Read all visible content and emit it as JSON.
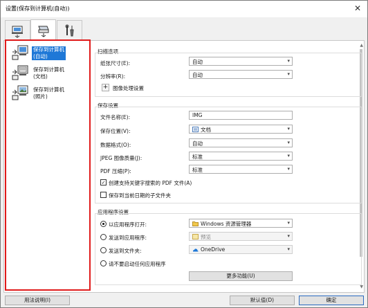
{
  "window": {
    "title": "设置(保存到计算机(自动))",
    "close": "✕"
  },
  "tabs": [
    {
      "name": "scan-from-computer",
      "active": false
    },
    {
      "name": "scan-from-operation-panel",
      "active": true
    },
    {
      "name": "general-settings",
      "active": false
    }
  ],
  "sidebar": {
    "items": [
      {
        "label_line1": "保存到计算机",
        "label_line2": "(自动)",
        "selected": true
      },
      {
        "label_line1": "保存到计算机",
        "label_line2": "(文档)",
        "selected": false
      },
      {
        "label_line1": "保存到计算机",
        "label_line2": "(照片)",
        "selected": false
      }
    ]
  },
  "scan_options": {
    "title": "扫描选项",
    "paper_size_label": "纸张尺寸(E):",
    "paper_size_value": "自动",
    "resolution_label": "分辨率(R):",
    "resolution_value": "自动",
    "image_processing_label": "图像处理设置"
  },
  "save_settings": {
    "title": "保存设置",
    "file_name_label": "文件名称(E):",
    "file_name_value": "IMG",
    "save_in_label": "保存位置(V):",
    "save_in_value": "文档",
    "data_format_label": "数据格式(O):",
    "data_format_value": "自动",
    "jpeg_quality_label": "JPEG 图像质量(J):",
    "jpeg_quality_value": "标准",
    "pdf_compression_label": "PDF 压缩(P):",
    "pdf_compression_value": "标准",
    "keyword_pdf_label": "创建支持关键字搜索的 PDF 文件(A)",
    "keyword_pdf_checked": true,
    "date_subfolder_label": "保存到当前日期的子文件夹",
    "date_subfolder_checked": false
  },
  "app_settings": {
    "title": "应用程序设置",
    "open_with_label": "以应用程序打开:",
    "open_with_value": "Windows 资源管理器",
    "send_to_app_label": "发送到应用程序:",
    "send_to_app_value": "预览",
    "send_to_folder_label": "发送到文件夹:",
    "send_to_folder_value": "OneDrive",
    "do_not_start_label": "请不要启动任何应用程序",
    "selected_option": "open_with",
    "more_functions_label": "更多功能(U)"
  },
  "footer": {
    "instructions_label": "用法说明(I)",
    "defaults_label": "默认值(D)",
    "ok_label": "确定"
  },
  "colors": {
    "highlight": "#1e78d7",
    "annotation_border": "#e01a1a"
  }
}
